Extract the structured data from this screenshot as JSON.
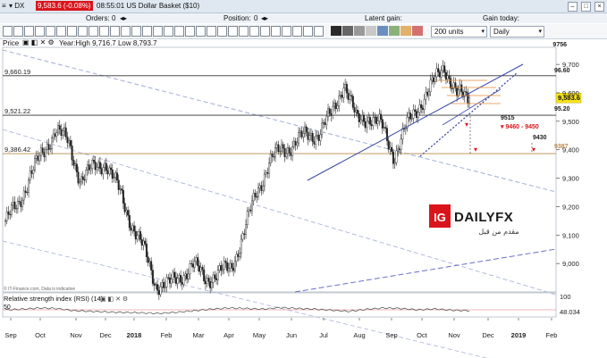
{
  "topbar": {
    "instrument": "DX",
    "price_badge": "9,583.6 (-0.08%)",
    "time_title": "08:55:01 US Dollar Basket ($10)"
  },
  "controls": {
    "orders_label": "Orders:",
    "orders_value": "0",
    "position_label": "Position:",
    "position_value": "0",
    "latent_gain_label": "Latent gain:",
    "gain_today_label": "Gain today:",
    "units_select": "200 units",
    "interval_select": "Daily"
  },
  "chart_header": {
    "price_label": "Price",
    "range_text": "Year:High 9,716.7 Low 8,793.7"
  },
  "rsi_panel": {
    "title": "Relative strength index (RSI) (14)",
    "level_50": "50",
    "level_100": "100",
    "current": "48.034"
  },
  "branding": {
    "ig": "IG",
    "dailyfx": "DAILYFX",
    "arabic": "مقدم من قبل",
    "source": "© IT-Finance.com, Data is indicative"
  },
  "chart_data": {
    "type": "candlestick",
    "x_ticks": [
      "Sep",
      "Oct",
      "Nov",
      "Dec",
      "2018",
      "Feb",
      "Mar",
      "Apr",
      "May",
      "Jun",
      "Jul",
      "Aug",
      "Sep",
      "Oct",
      "Nov",
      "Dec",
      "2019",
      "Feb"
    ],
    "y_ticks": [
      9000,
      9100,
      9200,
      9300,
      9400,
      9500,
      9600,
      9700
    ],
    "ylim": [
      8900,
      9760
    ],
    "close_series": [
      [
        "2017-09",
        9150
      ],
      [
        "2017-09-15",
        9200
      ],
      [
        "2017-10",
        9320
      ],
      [
        "2017-10-20",
        9380
      ],
      [
        "2017-11",
        9480
      ],
      [
        "2017-11-10",
        9420
      ],
      [
        "2017-11-25",
        9300
      ],
      [
        "2017-12",
        9330
      ],
      [
        "2017-12-15",
        9360
      ],
      [
        "2017-12-28",
        9260
      ],
      [
        "2018-01",
        9150
      ],
      [
        "2018-01-15",
        9050
      ],
      [
        "2018-01-25",
        8930
      ],
      [
        "2018-02",
        8920
      ],
      [
        "2018-02-15",
        8960
      ],
      [
        "2018-03",
        8990
      ],
      [
        "2018-03-15",
        8950
      ],
      [
        "2018-04",
        8960
      ],
      [
        "2018-04-15",
        8990
      ],
      [
        "2018-04-25",
        9100
      ],
      [
        "2018-05",
        9250
      ],
      [
        "2018-05-15",
        9350
      ],
      [
        "2018-06",
        9400
      ],
      [
        "2018-06-15",
        9420
      ],
      [
        "2018-07",
        9450
      ],
      [
        "2018-07-15",
        9460
      ],
      [
        "2018-08",
        9520
      ],
      [
        "2018-08-15",
        9640
      ],
      [
        "2018-08-25",
        9500
      ],
      [
        "2018-09",
        9520
      ],
      [
        "2018-09-15",
        9480
      ],
      [
        "2018-09-25",
        9380
      ],
      [
        "2018-10",
        9480
      ],
      [
        "2018-10-15",
        9560
      ],
      [
        "2018-11",
        9620
      ],
      [
        "2018-11-12",
        9700
      ],
      [
        "2018-11-20",
        9590
      ],
      [
        "2018-11-28",
        9583.6
      ]
    ],
    "horizontal_levels": [
      {
        "value": 9660.19,
        "label": "9,660.19"
      },
      {
        "value": 9521.22,
        "label": "9,521.22"
      },
      {
        "value": 9386.42,
        "label": "9,386.42"
      }
    ],
    "annotations": [
      {
        "label": "9756",
        "value": 9756
      },
      {
        "label": "96.60",
        "value": 9660
      },
      {
        "label": "95.20",
        "value": 9520
      },
      {
        "label": "9515",
        "value": 9515
      },
      {
        "label": "9460 - 9450",
        "value": 9455
      },
      {
        "label": "9430",
        "value": 9430
      },
      {
        "label": "9387",
        "value": 9387
      }
    ],
    "last_price": {
      "value": 9583.6,
      "label": "9,583.6"
    },
    "rsi_series": [
      52,
      55,
      60,
      58,
      48,
      45,
      42,
      40,
      38,
      36,
      41,
      48,
      55,
      60,
      58,
      55,
      62,
      58,
      55,
      50,
      45,
      54,
      60,
      58,
      52,
      56,
      50,
      48.034
    ]
  }
}
